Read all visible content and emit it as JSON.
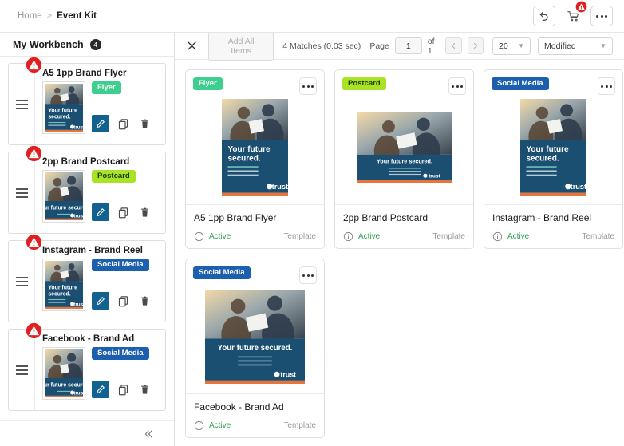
{
  "breadcrumb": {
    "home": "Home",
    "separator": ">",
    "current": "Event Kit"
  },
  "top_actions": {
    "undo": "undo-arrow",
    "cart": "shopping-cart",
    "more": "more-options"
  },
  "sidebar": {
    "title": "My Workbench",
    "count": "4",
    "collapse": "collapse-panel",
    "items": [
      {
        "name": "A5 1pp Brand Flyer",
        "tag": "Flyer",
        "tag_style": "pill-flyer",
        "thumb": "portrait"
      },
      {
        "name": "2pp Brand Postcard",
        "tag": "Postcard",
        "tag_style": "pill-postcard",
        "thumb": "landscape"
      },
      {
        "name": "Instagram - Brand Reel",
        "tag": "Social Media",
        "tag_style": "pill-social",
        "thumb": "portrait"
      },
      {
        "name": "Facebook - Brand Ad",
        "tag": "Social Media",
        "tag_style": "pill-social",
        "thumb": "landscape"
      }
    ],
    "item_actions": {
      "edit": "Edit",
      "copy": "Copy",
      "delete": "Delete"
    }
  },
  "results": {
    "close": "Close",
    "add_all_label": "Add All Items",
    "matches": "4 Matches (0.03 sec)",
    "page_label": "Page",
    "page_value": "1",
    "page_of": "of 1",
    "prev": "‹",
    "next": "›",
    "page_size": "20",
    "sort_by": "Modified",
    "cards": [
      {
        "tag": "Flyer",
        "tag_style": "pill-flyer",
        "title": "A5 1pp Brand Flyer",
        "status": "Active",
        "type": "Template",
        "thumb": "portrait",
        "thumb_headline": "Your future secured."
      },
      {
        "tag": "Postcard",
        "tag_style": "pill-postcard",
        "title": "2pp Brand Postcard",
        "status": "Active",
        "type": "Template",
        "thumb": "landscape",
        "thumb_headline": "Your future secured."
      },
      {
        "tag": "Social Media",
        "tag_style": "pill-social",
        "title": "Instagram - Brand Reel",
        "status": "Active",
        "type": "Template",
        "thumb": "portrait",
        "thumb_headline": "Your future secured."
      },
      {
        "tag": "Social Media",
        "tag_style": "pill-social",
        "title": "Facebook - Brand Ad",
        "status": "Active",
        "type": "Template",
        "thumb": "square",
        "thumb_headline": "Your future secured."
      }
    ]
  },
  "brand": {
    "logo_text": "trust",
    "accent_blue": "#1b4f72",
    "accent_orange": "#e8743b"
  }
}
